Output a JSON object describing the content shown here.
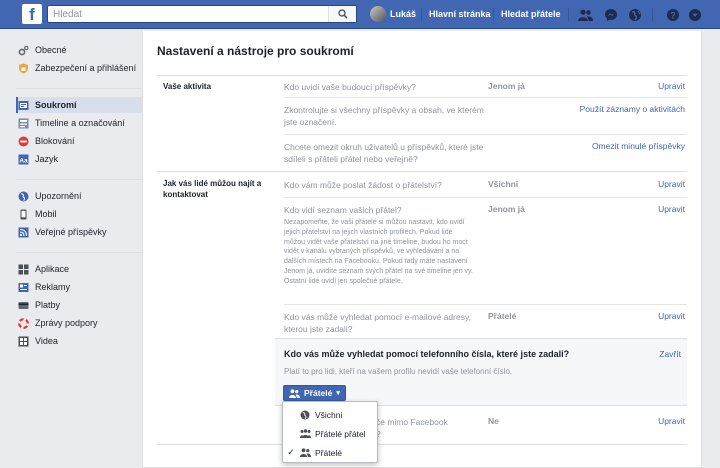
{
  "topbar": {
    "logo": "f",
    "search_placeholder": "Hledat",
    "user_name": "Lukáš",
    "home_link": "Hlavní stránka",
    "find_friends_link": "Hledat přátele"
  },
  "sidebar": {
    "groups": [
      [
        {
          "label": "Obecné",
          "icon": "gear-icon"
        },
        {
          "label": "Zabezpečení a přihlášení",
          "icon": "shield-icon"
        }
      ],
      [
        {
          "label": "Soukromí",
          "icon": "lock-icon",
          "active": true
        },
        {
          "label": "Timeline a označování",
          "icon": "timeline-icon"
        },
        {
          "label": "Blokování",
          "icon": "block-icon"
        },
        {
          "label": "Jazyk",
          "icon": "language-icon"
        }
      ],
      [
        {
          "label": "Upozornění",
          "icon": "globe-icon"
        },
        {
          "label": "Mobil",
          "icon": "mobile-icon"
        },
        {
          "label": "Veřejné příspěvky",
          "icon": "rss-icon"
        }
      ],
      [
        {
          "label": "Aplikace",
          "icon": "apps-icon"
        },
        {
          "label": "Reklamy",
          "icon": "ads-icon"
        },
        {
          "label": "Platby",
          "icon": "card-icon"
        },
        {
          "label": "Zprávy podpory",
          "icon": "lifebuoy-icon"
        },
        {
          "label": "Videa",
          "icon": "video-icon"
        }
      ]
    ]
  },
  "main": {
    "title": "Nastavení a nástroje pro soukromí",
    "section_activity": {
      "label": "Vaše aktivita",
      "rows": [
        {
          "question": "Kdo uvidí vaše budoucí příspěvky?",
          "value": "Jenom já",
          "action": "Upravit"
        },
        {
          "question": "Zkontrolujte si všechny příspěvky a obsah, ve kterém jste označení.",
          "value": "",
          "action": "Použít záznamy o aktivitách"
        },
        {
          "question": "Chcete omezit okruh uživatelů u příspěvků, které jste sdíleli s přáteli přátel nebo veřejně?",
          "value": "",
          "action": "Omezit minulé příspěvky"
        }
      ]
    },
    "section_contact": {
      "label": "Jak vás lidé můžou najít a kontaktovat",
      "rows": [
        {
          "question": "Kdo vám může poslat žádost o přátelství?",
          "value": "Všichni",
          "action": "Upravit"
        },
        {
          "question": "Kdo vidí seznam vašich přátel?",
          "description": "Nezapomeňte, že vaši přátelé si můžou nastavit, kdo uvidí jejich přátelství na jejich vlastních profilech. Pokud lidé můžou vidět vaše přátelství na jiné timeline, budou ho moct vidět v kanálu vybraných příspěvků, ve vyhledávání a na dalších místech na Facebooku. Pokud tady máte nastavení Jenom já, uvidíte seznam svých přátel na své timeline jen vy. Ostatní lidé uvidí jen společné přátele.",
          "value": "Jenom já",
          "action": "Upravit"
        },
        {
          "question": "Kdo vás může vyhledat pomocí e-mailové adresy, kterou jste zadali?",
          "value": "Přátelé",
          "action": "Upravit"
        }
      ],
      "expanded": {
        "title": "Kdo vás může vyhledat pomocí telefonního čísla, které jste zadali?",
        "subtitle": "Platí to pro lidi, kteří na vašem profilu nevidí vaše telefonní číslo.",
        "close": "Zavřít",
        "button": "Přátelé"
      },
      "last_row": {
        "question_a": "če mimo Facebook",
        "question_b": "?",
        "value": "Ne",
        "action": "Upravit"
      }
    }
  },
  "dropdown": {
    "options": [
      {
        "label": "Všichni",
        "icon": "globe-icon",
        "selected": false
      },
      {
        "label": "Přátelé přátel",
        "icon": "friends-of-friends-icon",
        "selected": false
      },
      {
        "label": "Přátelé",
        "icon": "friends-icon",
        "selected": true
      }
    ]
  }
}
